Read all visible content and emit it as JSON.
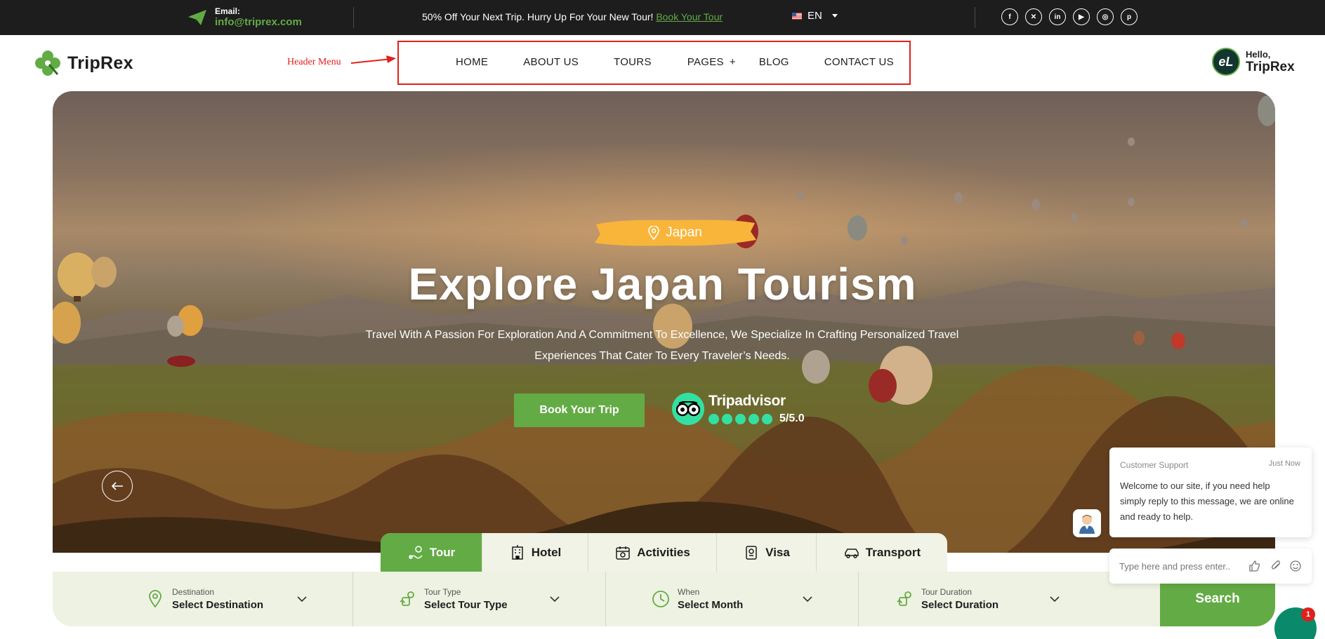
{
  "topbar": {
    "email_label": "Email:",
    "email_value": "info@triprex.com",
    "promo_text": "50% Off Your Next Trip. Hurry Up For Your New Tour!",
    "promo_link": "Book Your Tour",
    "language": "EN",
    "social_icons": [
      "facebook-icon",
      "x-icon",
      "linkedin-icon",
      "youtube-icon",
      "instagram-icon",
      "pinterest-icon"
    ]
  },
  "header": {
    "logo_text": "TripRex",
    "annotation_label": "Header Menu",
    "nav": {
      "home": "HOME",
      "about": "ABOUT US",
      "tours": "TOURS",
      "pages": "PAGES",
      "pages_plus": "+",
      "blog": "BLOG",
      "contact": "CONTACT US"
    },
    "avatar_initials": "eL",
    "hello_line1": "Hello,",
    "hello_line2": "TripRex"
  },
  "hero": {
    "location_tag": "Japan",
    "title": "Explore Japan Tourism",
    "subtitle": "Travel With A Passion For Exploration And A Commitment To Excellence, We Specialize In Crafting Personalized Travel Experiences That Cater To Every Traveler’s Needs.",
    "cta_label": "Book Your Trip",
    "tripadvisor_name": "Tripadvisor",
    "tripadvisor_score": "5/5.0",
    "tripadvisor_rating": 5
  },
  "search": {
    "tabs": {
      "tour": "Tour",
      "hotel": "Hotel",
      "activities": "Activities",
      "visa": "Visa",
      "transport": "Transport"
    },
    "active_tab": "Tour",
    "fields": {
      "destination_label": "Destination",
      "destination_value": "Select Destination",
      "tour_type_label": "Tour Type",
      "tour_type_value": "Select Tour Type",
      "when_label": "When",
      "when_value": "Select Month",
      "duration_label": "Tour Duration",
      "duration_value": "Select Duration"
    },
    "button_label": "Search"
  },
  "chat": {
    "from": "Customer Support",
    "time": "Just Now",
    "message": "Welcome to our site, if you need help simply reply to this message, we are online and ready to help.",
    "input_placeholder": "Type here and press enter..",
    "unread_count": "1"
  },
  "colors": {
    "brand_green": "#63ab45",
    "topbar_bg": "#1d1d1d",
    "annotation_red": "#e0201c",
    "tag_orange": "#f9b53a",
    "tripadvisor_green": "#34e0a1"
  }
}
